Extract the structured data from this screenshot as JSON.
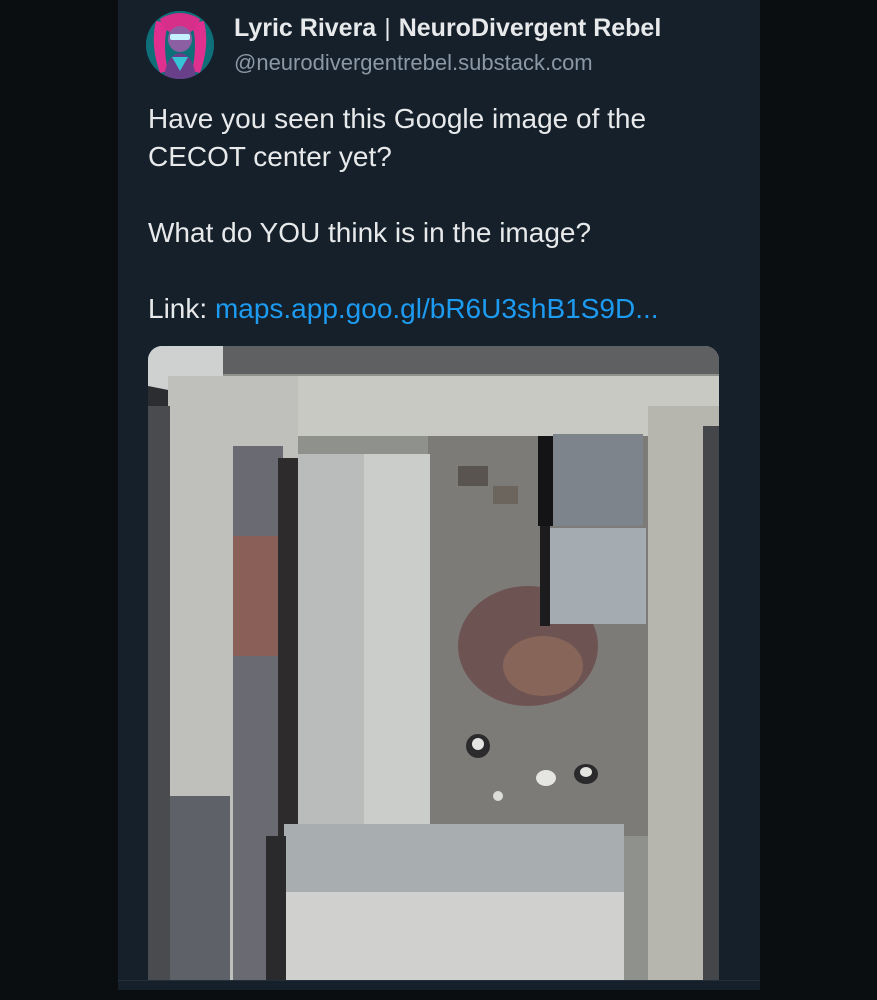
{
  "author": {
    "display_name": "Lyric Rivera",
    "separator": "|",
    "brand_name": "NeuroDivergent Rebel",
    "handle": "@neurodivergentrebel.substack.com",
    "avatar_icon": "profile-avatar"
  },
  "post": {
    "line1": "Have you seen this Google image of the",
    "line2": "CECOT center yet?",
    "line3": "What do YOU think is in the image?",
    "link_label": "Link:",
    "link_text": "maps.app.goo.gl/bR6U3shB1S9D..."
  },
  "media": {
    "type": "satellite-image"
  },
  "colors": {
    "background": "#15202b",
    "outer_background": "#0b0e11",
    "text": "#e7e9ea",
    "secondary_text": "#8b98a5",
    "link": "#1d9bf0"
  }
}
